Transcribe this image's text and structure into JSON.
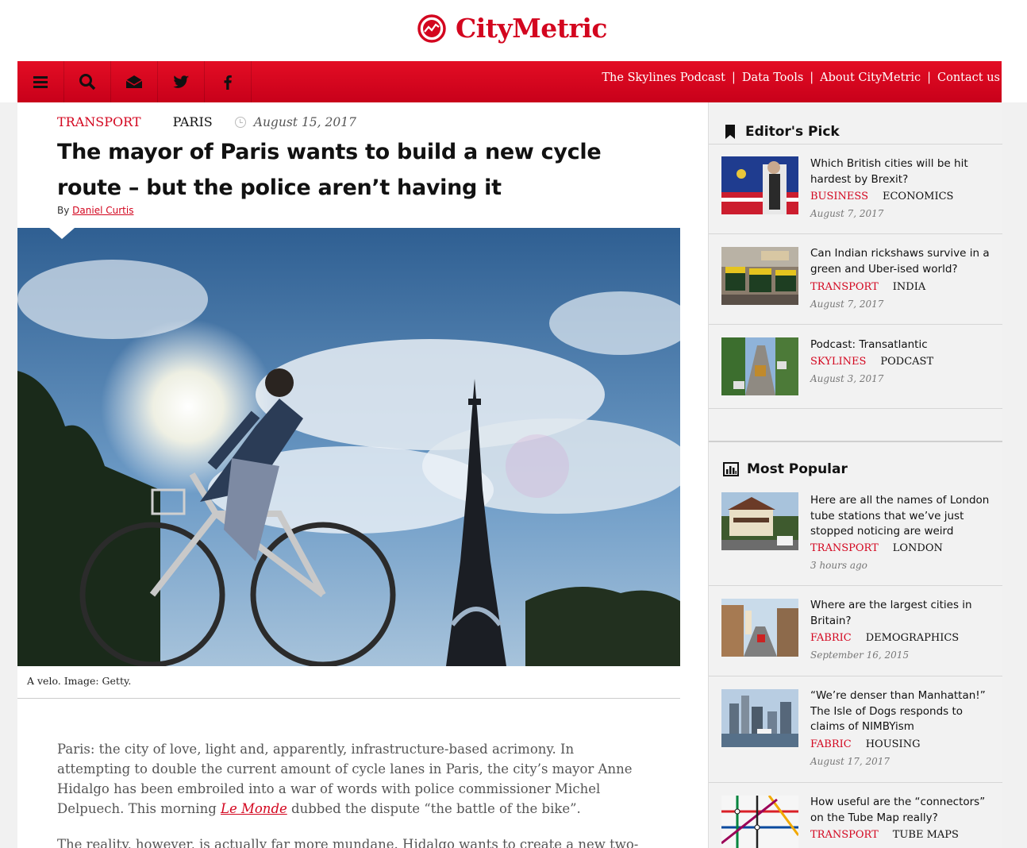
{
  "brand": {
    "name": "CityMetric",
    "color": "#d3061f"
  },
  "nav": {
    "icons": [
      "menu-icon",
      "search-icon",
      "newsletter-icon",
      "twitter-icon",
      "facebook-icon"
    ],
    "links": [
      "The Skylines Podcast",
      "Data Tools",
      "About CityMetric",
      "Contact us"
    ],
    "separator": "|"
  },
  "article": {
    "category": "TRANSPORT",
    "place": "PARIS",
    "date": "August 15, 2017",
    "headline": "The mayor of Paris wants to build a new cycle route – but the police aren’t having it",
    "byline_prefix": "By",
    "author": "Daniel Curtis",
    "caption": "A velo. Image: Getty.",
    "paragraph1_a": "Paris: the city of love, light and, apparently, infrastructure-based acrimony. In attempting to double the current amount of cycle lanes in Paris, the city’s mayor Anne Hidalgo has been embroiled into a war of words with police commissioner Michel Delpuech. This morning",
    "paragraph1_link": "Le Monde",
    "paragraph1_b": "dubbed the dispute “the battle of the bike”.",
    "paragraph2": "The reality, however, is actually far more mundane. Hidalgo wants to create a new two-"
  },
  "sidebar": {
    "editors_pick": {
      "title": "Editor's Pick",
      "items": [
        {
          "title": "Which British cities will be hit hardest by Brexit?",
          "tag1": "BUSINESS",
          "tag2": "ECONOMICS",
          "date": "August 7, 2017"
        },
        {
          "title": "Can Indian rickshaws survive in a green and Uber-ised world?",
          "tag1": "TRANSPORT",
          "tag2": "INDIA",
          "date": "August 7, 2017"
        },
        {
          "title": "Podcast: Transatlantic",
          "tag1": "SKYLINES",
          "tag2": "PODCAST",
          "date": "August 3, 2017"
        }
      ]
    },
    "most_popular": {
      "title": "Most Popular",
      "items": [
        {
          "title": "Here are all the names of London tube stations that we’ve just stopped noticing are weird",
          "tag1": "TRANSPORT",
          "tag2": "LONDON",
          "date": "3 hours ago"
        },
        {
          "title": "Where are the largest cities in Britain?",
          "tag1": "FABRIC",
          "tag2": "DEMOGRAPHICS",
          "date": "September 16, 2015"
        },
        {
          "title": "“We’re denser than Manhattan!” The Isle of Dogs responds to claims of NIMBYism",
          "tag1": "FABRIC",
          "tag2": "HOUSING",
          "date": "August 17, 2017"
        },
        {
          "title": "How useful are the “connectors” on the Tube Map really?",
          "tag1": "TRANSPORT",
          "tag2": "TUBE MAPS",
          "date": ""
        }
      ]
    }
  }
}
